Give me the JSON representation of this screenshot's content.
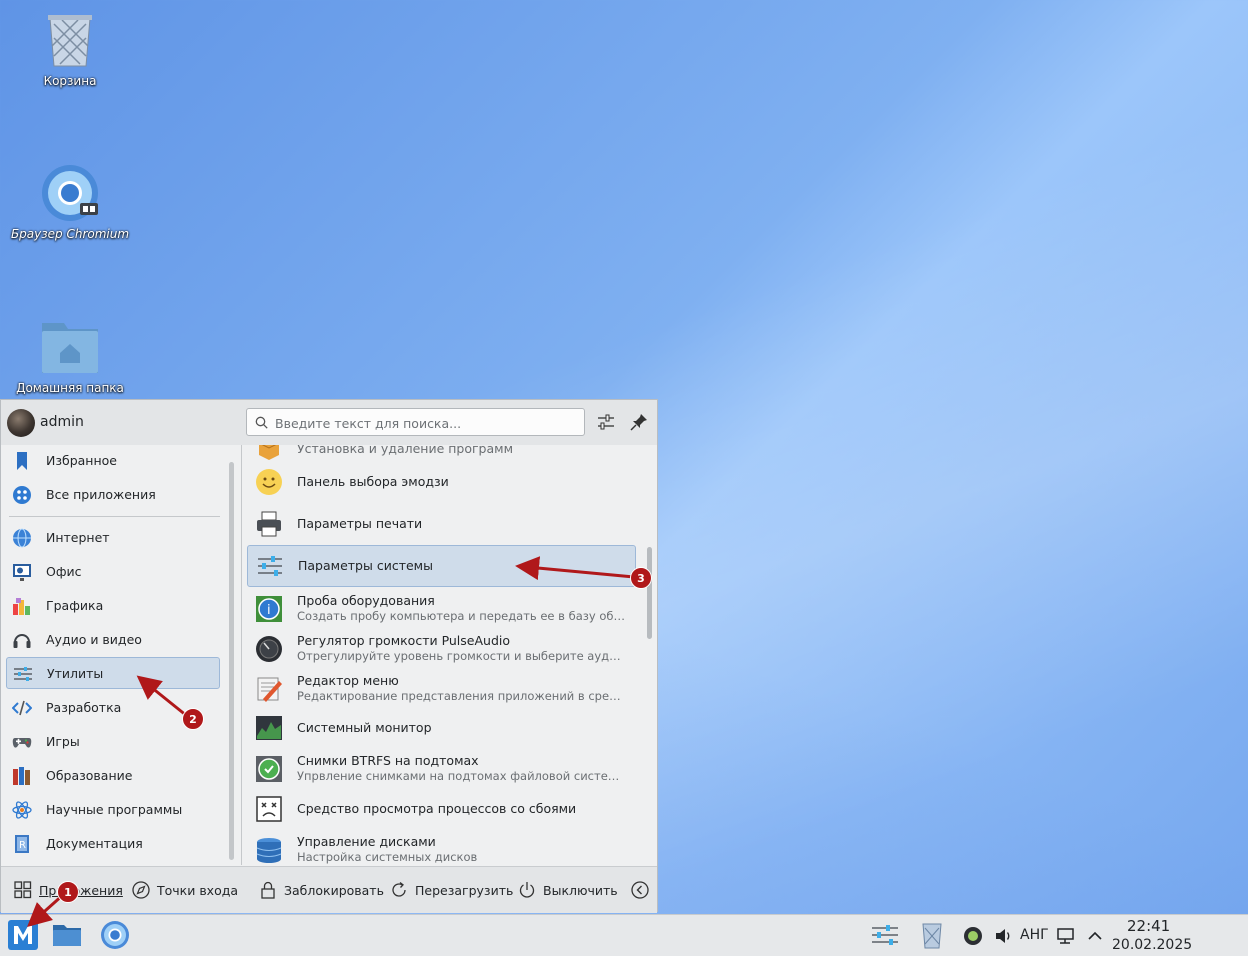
{
  "desktop": {
    "icons": [
      {
        "label": "Корзина"
      },
      {
        "label": "Браузер Chromium"
      },
      {
        "label": "Домашняя папка"
      }
    ]
  },
  "menu": {
    "user": "admin",
    "search": {
      "placeholder": "Введите текст для поиска..."
    },
    "categories": [
      {
        "label": "Избранное",
        "icon": "bookmark-icon"
      },
      {
        "label": "Все приложения",
        "icon": "grid-dots-icon"
      },
      {
        "label": "Интернет",
        "icon": "globe-icon"
      },
      {
        "label": "Офис",
        "icon": "office-icon"
      },
      {
        "label": "Графика",
        "icon": "graphics-icon"
      },
      {
        "label": "Аудио и видео",
        "icon": "headphones-icon"
      },
      {
        "label": "Утилиты",
        "icon": "sliders-icon",
        "selected": true
      },
      {
        "label": "Разработка",
        "icon": "code-icon"
      },
      {
        "label": "Игры",
        "icon": "gamepad-icon"
      },
      {
        "label": "Образование",
        "icon": "books-icon"
      },
      {
        "label": "Научные программы",
        "icon": "atom-icon"
      },
      {
        "label": "Документация",
        "icon": "document-icon"
      }
    ],
    "apps": [
      {
        "title": "Установка и удаление программ",
        "desc": ""
      },
      {
        "title": "Панель выбора эмодзи",
        "desc": ""
      },
      {
        "title": "Параметры печати",
        "desc": ""
      },
      {
        "title": "Параметры системы",
        "desc": "",
        "selected": true
      },
      {
        "title": "Проба оборудования",
        "desc": "Создать пробу компьютера и передать ее в базу оборуд..."
      },
      {
        "title": "Регулятор громкости PulseAudio",
        "desc": "Отрегулируйте уровень громкости и выберите аудиоуст..."
      },
      {
        "title": "Редактор меню",
        "desc": "Редактирование представления приложений в средства..."
      },
      {
        "title": "Системный монитор",
        "desc": ""
      },
      {
        "title": "Снимки BTRFS на подтомах",
        "desc": "Упрвление снимками на подтомах файловой системы B..."
      },
      {
        "title": "Средство просмотра процессов со сбоями",
        "desc": ""
      },
      {
        "title": "Управление дисками",
        "desc": "Настройка системных дисков"
      }
    ],
    "footer": {
      "applications": "Приложения",
      "places": "Точки входа",
      "lock": "Заблокировать",
      "restart": "Перезагрузить",
      "shutdown": "Выключить"
    }
  },
  "taskbar": {
    "lang": "АНГ",
    "time": "22:41",
    "date": "20.02.2025"
  },
  "annotations": [
    {
      "number": "1"
    },
    {
      "number": "2"
    },
    {
      "number": "3"
    }
  ],
  "colors": {
    "selection": "#cfdcea",
    "accent": "#3daee9",
    "annotation": "#b0181a"
  }
}
